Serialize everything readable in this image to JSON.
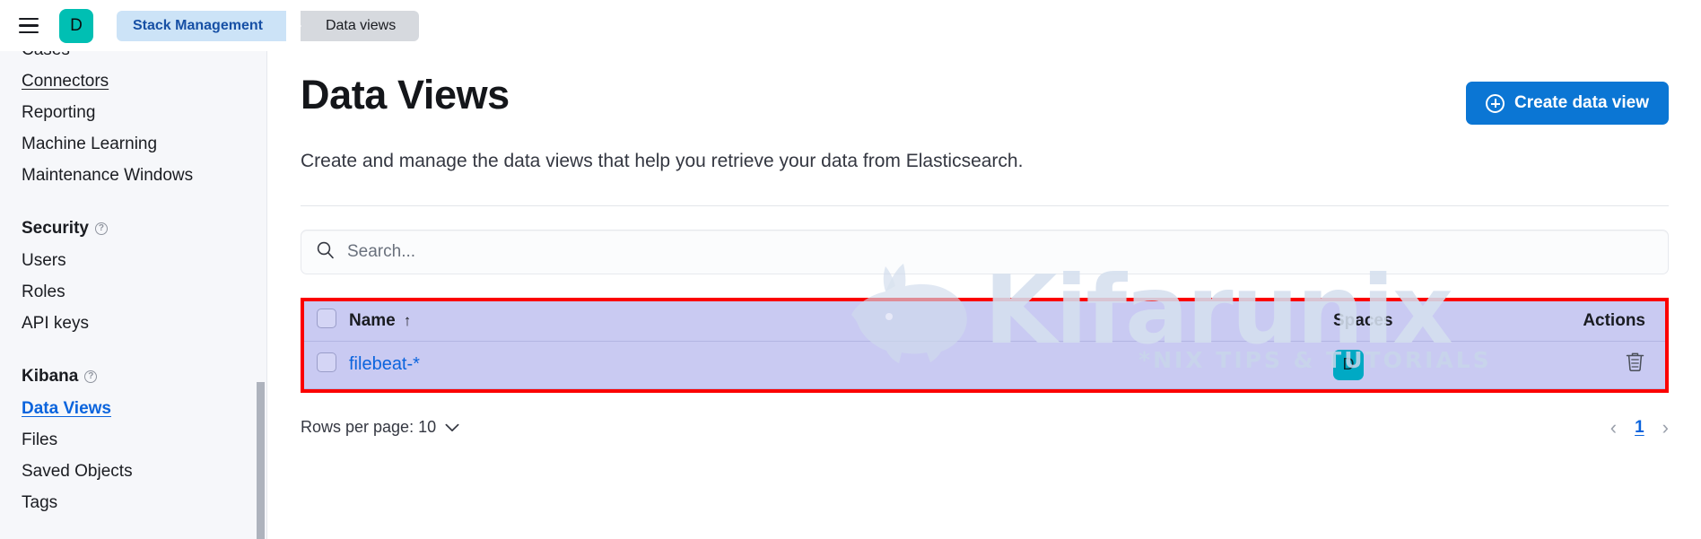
{
  "topbar": {
    "menu_icon": "hamburger-menu-icon",
    "space_avatar_letter": "D",
    "breadcrumbs": [
      {
        "label": "Stack Management",
        "active": true
      },
      {
        "label": "Data views",
        "active": false
      }
    ]
  },
  "sidebar": {
    "items": [
      {
        "label": "Cases",
        "style": "plain"
      },
      {
        "label": "Connectors",
        "style": "underlined"
      },
      {
        "label": "Reporting",
        "style": "plain"
      },
      {
        "label": "Machine Learning",
        "style": "plain"
      },
      {
        "label": "Maintenance Windows",
        "style": "plain"
      }
    ],
    "groups": [
      {
        "title": "Security",
        "help_icon": "question-mark-icon",
        "items": [
          {
            "label": "Users",
            "style": "plain"
          },
          {
            "label": "Roles",
            "style": "plain"
          },
          {
            "label": "API keys",
            "style": "plain"
          }
        ]
      },
      {
        "title": "Kibana",
        "help_icon": "question-mark-icon",
        "items": [
          {
            "label": "Data Views",
            "style": "active"
          },
          {
            "label": "Files",
            "style": "plain"
          },
          {
            "label": "Saved Objects",
            "style": "plain"
          },
          {
            "label": "Tags",
            "style": "plain"
          }
        ]
      }
    ]
  },
  "main": {
    "title": "Data Views",
    "description": "Create and manage the data views that help you retrieve your data from Elasticsearch.",
    "create_button": {
      "label": "Create data view",
      "icon": "plus-circle-icon",
      "color": "#0b76d4"
    },
    "search": {
      "placeholder": "Search...",
      "value": "",
      "icon": "search-icon"
    },
    "table": {
      "highlight_color": "#fb0000",
      "row_background": "#c9caf2",
      "columns": [
        {
          "key": "select",
          "label": ""
        },
        {
          "key": "name",
          "label": "Name",
          "sort": "↑"
        },
        {
          "key": "spaces",
          "label": "Spaces"
        },
        {
          "key": "actions",
          "label": "Actions"
        }
      ],
      "rows": [
        {
          "name": "filebeat-*",
          "space_badge": "D",
          "space_badge_color": "#00a9c4",
          "action_icon": "trash-icon"
        }
      ]
    },
    "pagination": {
      "rows_per_page_label": "Rows per page: 10",
      "chevron_icon": "chevron-down-icon",
      "prev_icon": "chevron-left-icon",
      "next_icon": "chevron-right-icon",
      "current_page": "1"
    }
  },
  "watermark": {
    "brand": "Kifarunix",
    "tagline": "*NIX TIPS & TUTORIALS",
    "mark_icon": "rhino-logo-icon"
  }
}
